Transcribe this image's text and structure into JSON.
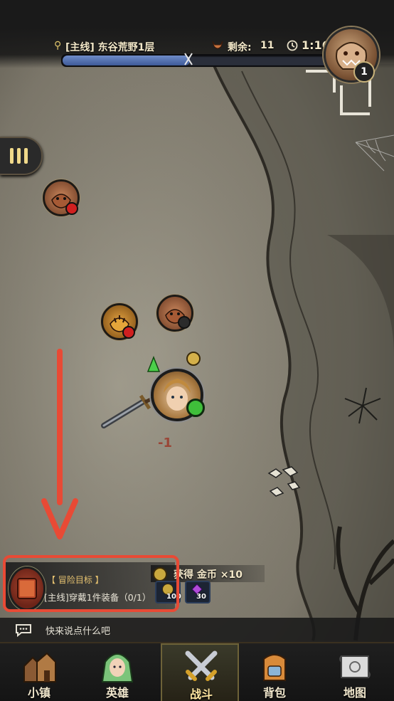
{
  "header": {
    "quest_location": "[主线] 东谷荒野1层",
    "remaining_label": "剩余:",
    "remaining_count": "11",
    "timer": "1:16",
    "progress_fraction": 0.47,
    "boss_level": "1"
  },
  "map": {
    "damage_text": "-1"
  },
  "quest": {
    "title": "【 冒险目标 】",
    "description": "[主线]穿戴1件装备（0/1）"
  },
  "loot": {
    "gain_text": "获得 金币  ×10",
    "items": [
      {
        "icon": "gold-coin-icon",
        "count": "100"
      },
      {
        "icon": "purple-crystal-icon",
        "count": "30"
      }
    ]
  },
  "chat": {
    "placeholder": "快来说点什么吧"
  },
  "nav": {
    "tabs": [
      {
        "label": "小镇",
        "icon": "town-icon"
      },
      {
        "label": "英雄",
        "icon": "hero-icon"
      },
      {
        "label": "战斗",
        "icon": "crossed-swords-icon",
        "active": true
      },
      {
        "label": "背包",
        "icon": "backpack-icon"
      },
      {
        "label": "地图",
        "icon": "map-scroll-icon"
      }
    ]
  },
  "colors": {
    "annotation_red": "#e84a35",
    "progress_blue": "#5b78b8",
    "hero_status_green": "#3fbf3a",
    "enemy_status_red": "#d02020"
  }
}
